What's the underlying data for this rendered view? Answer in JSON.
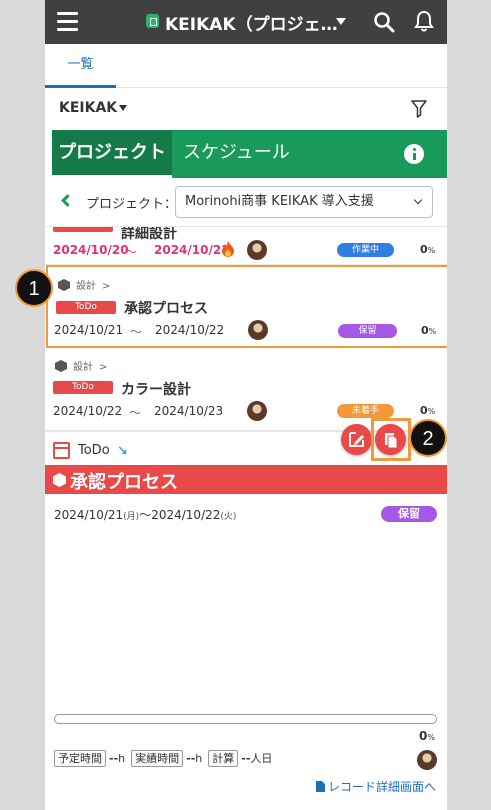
{
  "header": {
    "app_title": "KEIKAK（プロジェ…"
  },
  "tabs": {
    "list_label": "一覧"
  },
  "filter": {
    "app_select_label": "KEIKAK"
  },
  "green_tabs": {
    "project": "プロジェクト",
    "schedule": "スケジュール"
  },
  "project_selector": {
    "label": "プロジェクト：",
    "value": "Morinohi商事 KEIKAK 導入支援"
  },
  "tasks": [
    {
      "title": "詳細設計",
      "start": "2024/10/20",
      "end": "2024/10/21",
      "tilde": "〜",
      "status": "作業中",
      "status_color": "#2f7fe0",
      "progress": "0",
      "progress_unit": "%",
      "date_color": "#e0307a"
    },
    {
      "path": "設計",
      "path_arrow": ">",
      "tag": "ToDo",
      "title": "承認プロセス",
      "start": "2024/10/21",
      "end": "2024/10/22",
      "tilde": "〜",
      "status": "保留",
      "status_color": "#a558e3",
      "progress": "0",
      "progress_unit": "%"
    },
    {
      "path": "設計",
      "path_arrow": ">",
      "tag": "ToDo",
      "title": "カラー設計",
      "start": "2024/10/22",
      "end": "2024/10/23",
      "tilde": "〜",
      "status": "未着手",
      "status_color": "#f29a3a",
      "progress": "0",
      "progress_unit": "%"
    }
  ],
  "callouts": {
    "one": "1",
    "two": "2"
  },
  "detail": {
    "type": "ToDo",
    "trend": "↘",
    "title": "承認プロセス",
    "start": "2024/10/21",
    "start_dow": "(月)",
    "separator": "〜",
    "end": "2024/10/22",
    "end_dow": "(火)",
    "status": "保留",
    "progress": "0",
    "progress_fraction": 0,
    "progress_unit": "%",
    "planned_label": "予定時間",
    "planned_value": "--",
    "planned_unit": "h",
    "actual_label": "実績時間",
    "actual_value": "--",
    "actual_unit": "h",
    "calc_label": "計算",
    "calc_value": "--",
    "calc_unit": "人日",
    "record_link": "レコード詳細画面へ"
  },
  "colors": {
    "accent_green": "#1a9a5a",
    "todo_red": "#e84a4a",
    "highlight_orange": "#f29a3a"
  }
}
